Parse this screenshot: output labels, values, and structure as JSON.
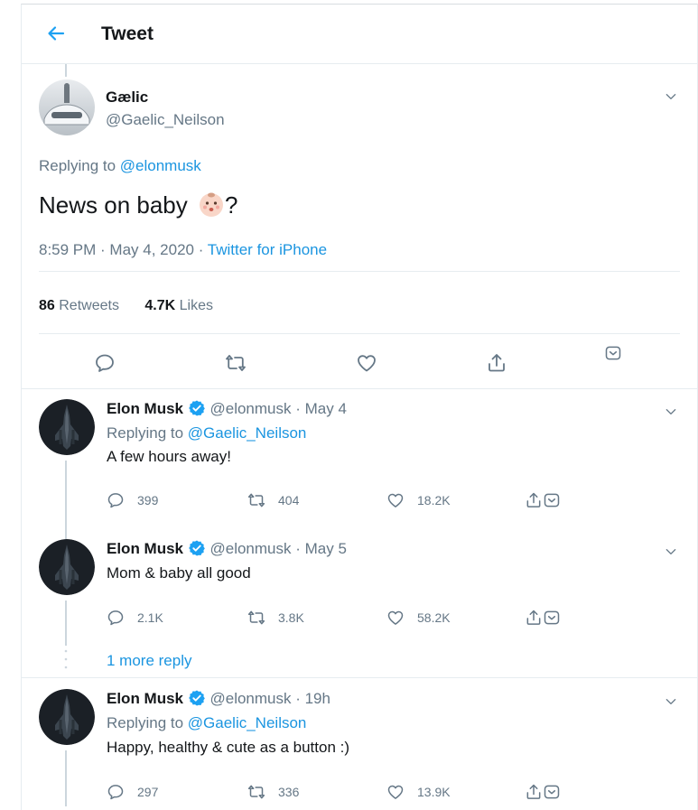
{
  "header": {
    "title": "Tweet"
  },
  "main_tweet": {
    "name": "Gælic",
    "handle": "@Gaelic_Neilson",
    "replying_prefix": "Replying to ",
    "replying_to": "@elonmusk",
    "text": "News on baby",
    "text_suffix": "?",
    "time": "8:59 PM · May 4, 2020 · ",
    "source": "Twitter for iPhone",
    "retweets_count": "86",
    "retweets_label": " Retweets",
    "likes_count": "4.7K",
    "likes_label": " Likes"
  },
  "replies": [
    {
      "name": "Elon Musk",
      "handle": "@elonmusk · May 4",
      "replying_prefix": "Replying to ",
      "replying_to": "@Gaelic_Neilson",
      "text": "A few hours away!",
      "replies": "399",
      "retweets": "404",
      "likes": "18.2K"
    },
    {
      "name": "Elon Musk",
      "handle": "@elonmusk · May 5",
      "text": "Mom & baby all good",
      "replies": "2.1K",
      "retweets": "3.8K",
      "likes": "58.2K"
    },
    {
      "name": "Elon Musk",
      "handle": "@elonmusk · 19h",
      "replying_prefix": "Replying to ",
      "replying_to": "@Gaelic_Neilson",
      "text": "Happy, healthy & cute as a button :)",
      "replies": "297",
      "retweets": "336",
      "likes": "13.9K"
    }
  ],
  "more_replies": "1 more reply",
  "colors": {
    "accent": "#1da1f2",
    "link": "#1b95e0",
    "muted": "#657786",
    "verified": "#1da1f2"
  },
  "icons": [
    "back-arrow-icon",
    "chevron-down-icon",
    "reply-icon",
    "retweet-icon",
    "like-icon",
    "share-icon",
    "verified-badge-icon",
    "baby-emoji-icon"
  ]
}
